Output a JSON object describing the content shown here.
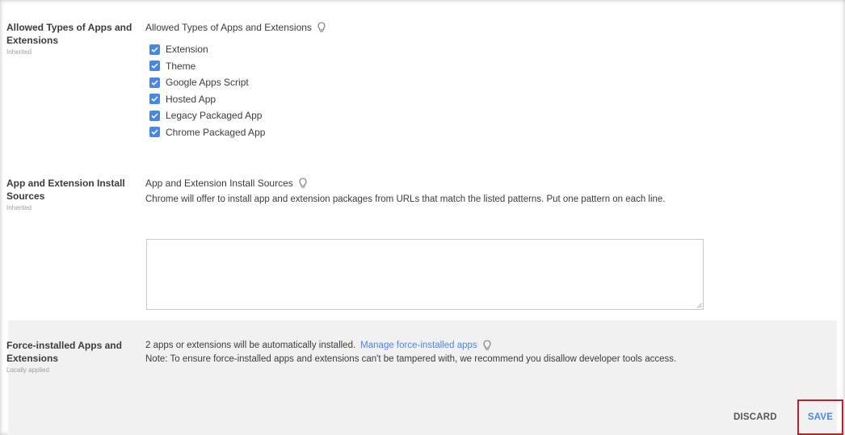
{
  "sections": {
    "allowed_types": {
      "left_title": "Allowed Types of Apps and Extensions",
      "left_sub": "Inherited",
      "title": "Allowed Types of Apps and Extensions",
      "options": [
        {
          "label": "Extension",
          "checked": true
        },
        {
          "label": "Theme",
          "checked": true
        },
        {
          "label": "Google Apps Script",
          "checked": true
        },
        {
          "label": "Hosted App",
          "checked": true
        },
        {
          "label": "Legacy Packaged App",
          "checked": true
        },
        {
          "label": "Chrome Packaged App",
          "checked": true
        }
      ]
    },
    "install_sources": {
      "left_title": "App and Extension Install Sources",
      "left_sub": "Inherited",
      "title": "App and Extension Install Sources",
      "description": "Chrome will offer to install app and extension packages from URLs that match the listed patterns. Put one pattern on each line.",
      "textarea_value": ""
    },
    "force_installed": {
      "left_title": "Force-installed Apps and Extensions",
      "left_sub": "Locally applied",
      "summary": "2 apps or extensions will be automatically installed.",
      "link": "Manage force-installed apps",
      "note": "Note: To ensure force-installed apps and extensions can't be tampered with, we recommend you disallow developer tools access."
    }
  },
  "footer": {
    "discard_label": "DISCARD",
    "save_label": "SAVE"
  },
  "colors": {
    "accent": "#4a86e8",
    "highlight_border": "#c0202b",
    "band": "#f1f1f1"
  },
  "icons": [
    "lightbulb-icon",
    "checkbox-checked-icon",
    "resize-grip-icon"
  ]
}
